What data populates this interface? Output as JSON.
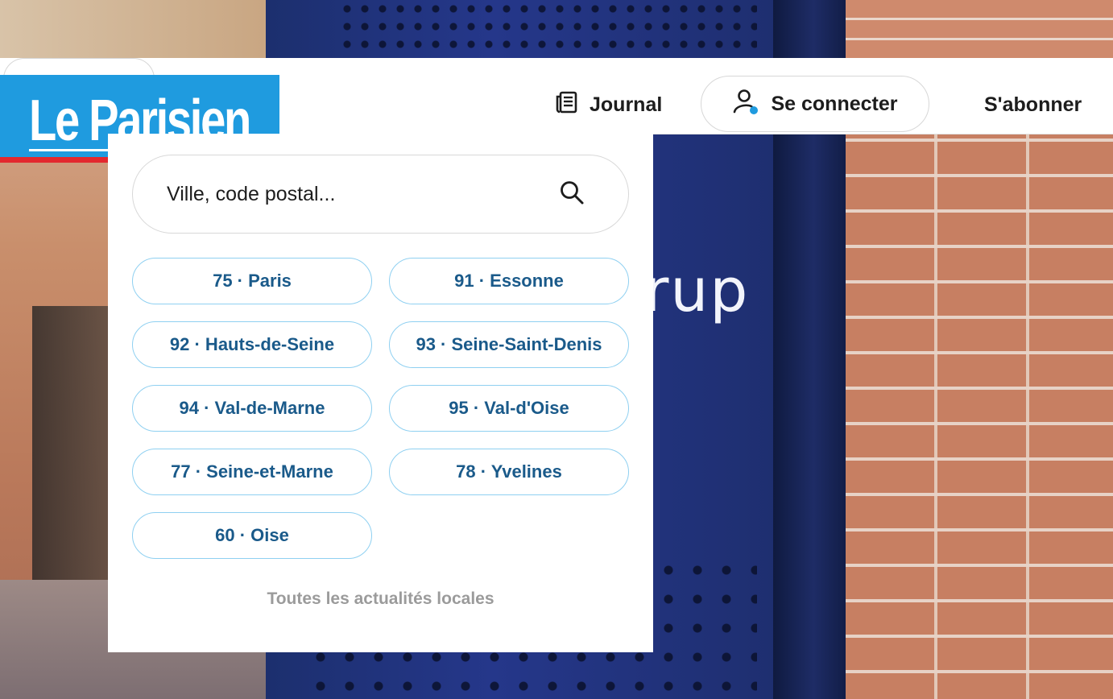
{
  "header": {
    "logo_text": "Le Parisien",
    "journal_label": "Journal",
    "login_label": "Se connecter",
    "subscribe_label": "S'abonner"
  },
  "background": {
    "sign_text": "rup"
  },
  "search": {
    "placeholder": "Ville, code postal..."
  },
  "departments": [
    {
      "label": "75 · Paris"
    },
    {
      "label": "91 · Essonne"
    },
    {
      "label": "92 · Hauts-de-Seine"
    },
    {
      "label": "93 · Seine-Saint-Denis"
    },
    {
      "label": "94 · Val-de-Marne"
    },
    {
      "label": "95 · Val-d'Oise"
    },
    {
      "label": "77 · Seine-et-Marne"
    },
    {
      "label": "78 · Yvelines"
    },
    {
      "label": "60 · Oise"
    }
  ],
  "footer_link": "Toutes les actualités locales",
  "colors": {
    "logo_blue": "#1f9bdf",
    "logo_red": "#e3282e",
    "chip_border": "#8fd0f1",
    "chip_text": "#1a5a8a",
    "user_dot": "#1f9bdf"
  },
  "icons": {
    "journal": "newspaper-icon",
    "login": "user-icon",
    "search": "search-icon"
  }
}
